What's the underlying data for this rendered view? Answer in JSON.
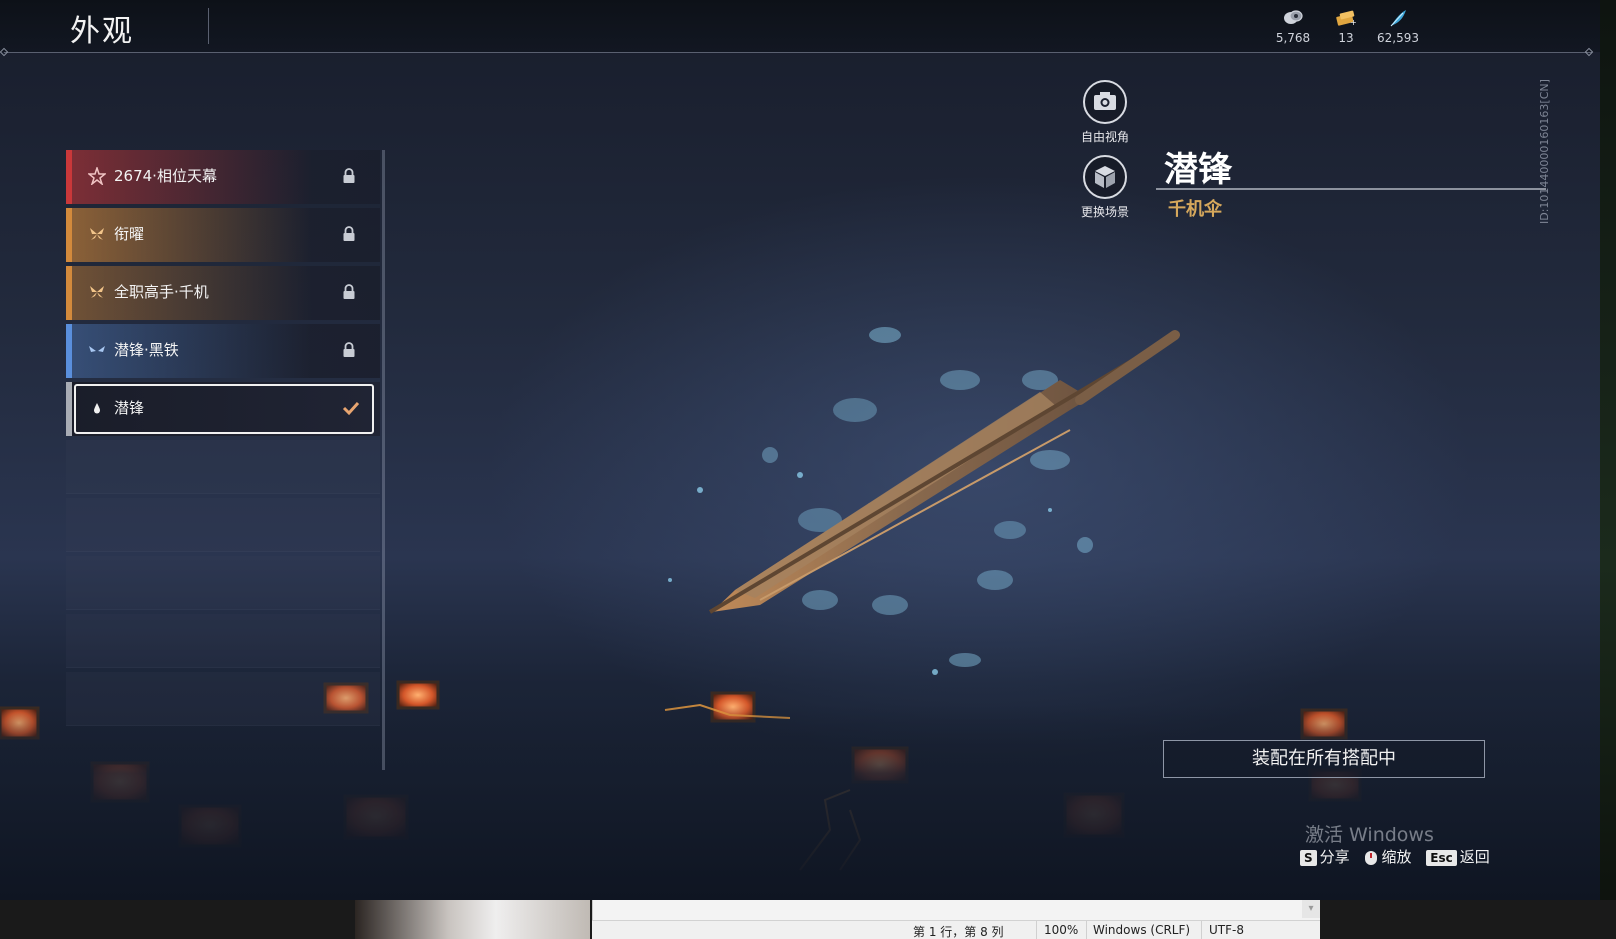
{
  "header": {
    "title": "外观",
    "currencies": [
      {
        "icon": "coin-stack-icon",
        "value": "5,768"
      },
      {
        "icon": "ticket-icon",
        "value": "13"
      },
      {
        "icon": "feather-icon",
        "value": "62,593"
      }
    ]
  },
  "colors": {
    "red": "#c9383a",
    "orange": "#d38a3c",
    "blue": "#5a8fdc",
    "white": "#f0f0f0",
    "gold_text": "#d6a85c",
    "check": "#e8a570"
  },
  "skin_list": [
    {
      "label": "2674·相位天幕",
      "icon": "star-icon",
      "color": "#c9383a",
      "state": "locked"
    },
    {
      "label": "衔曜",
      "icon": "butterfly-icon",
      "color": "#d38a3c",
      "state": "locked"
    },
    {
      "label": "全职高手·千机",
      "icon": "butterfly-icon",
      "color": "#d38a3c",
      "state": "locked"
    },
    {
      "label": "潜锋·黑铁",
      "icon": "wing-icon",
      "color": "#5a8fdc",
      "state": "locked"
    },
    {
      "label": "潜锋",
      "icon": "drop-icon",
      "color": "#f0f0f0",
      "state": "equipped"
    }
  ],
  "tools": {
    "free_camera": "自由视角",
    "change_scene": "更换场景"
  },
  "item": {
    "name": "潜锋",
    "type": "千机伞",
    "side_id": "ID:101440000160163[CN]"
  },
  "equip_button": "装配在所有搭配中",
  "hints": {
    "watermark": "激活 Windows",
    "share_key": "S",
    "share_label": "分享",
    "zoom_label": "缩放",
    "back_key": "Esc",
    "back_label": "返回"
  },
  "notepad_status": {
    "position": "第 1 行，第 8 列",
    "zoom": "100%",
    "line_ending": "Windows (CRLF)",
    "encoding": "UTF-8"
  }
}
